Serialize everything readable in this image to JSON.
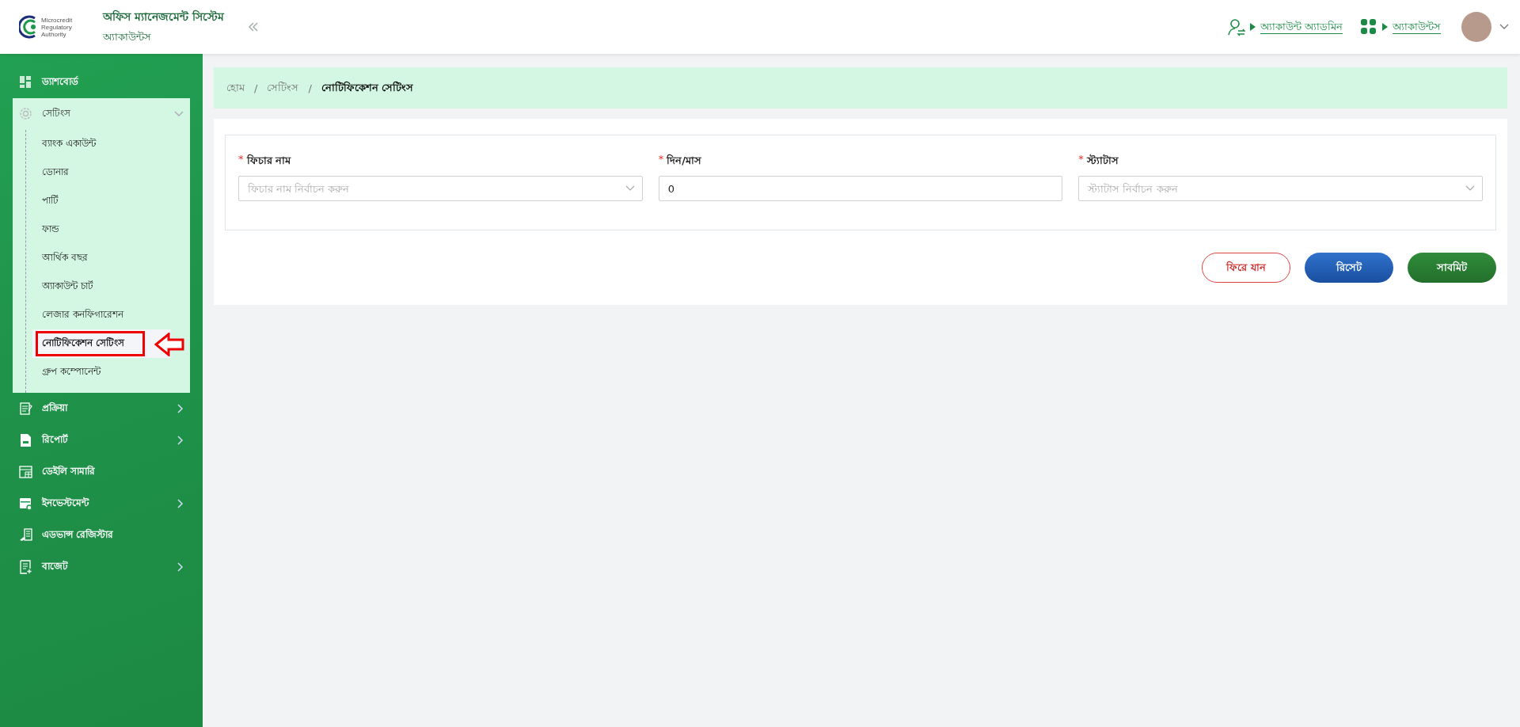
{
  "header": {
    "logo_lines": [
      "Microcredit",
      "Regulatory",
      "Authority"
    ],
    "title": "অফিস ম্যানেজমেন্ট সিস্টেম",
    "subtitle": "অ্যাকাউন্টস",
    "nav_links": [
      {
        "kind": "user-switch",
        "label": "অ্যাকাউন্ট অ্যাডমিন"
      },
      {
        "kind": "apps",
        "label": "অ্যাকাউন্টস"
      }
    ]
  },
  "sidebar": {
    "items": [
      {
        "label": "ড্যাশবোর্ড",
        "kind": "link"
      },
      {
        "label": "সেটিংস",
        "kind": "group",
        "expanded": true,
        "children": [
          {
            "label": "ব্যাংক একাউন্ট",
            "selected": false,
            "annotated": false
          },
          {
            "label": "ডোনার",
            "selected": false,
            "annotated": false
          },
          {
            "label": "পার্টি",
            "selected": false,
            "annotated": false
          },
          {
            "label": "ফান্ড",
            "selected": false,
            "annotated": false
          },
          {
            "label": "আর্থিক বছর",
            "selected": false,
            "annotated": false
          },
          {
            "label": "অ্যাকাউন্ট চার্ট",
            "selected": false,
            "annotated": false
          },
          {
            "label": "লেজার কনফিগারেশন",
            "selected": false,
            "annotated": false
          },
          {
            "label": "নোটিফিকেশন সেটিংস",
            "selected": true,
            "annotated": true
          },
          {
            "label": "গ্রুপ কম্পোনেন্ট",
            "selected": false,
            "annotated": false
          }
        ]
      },
      {
        "label": "প্রক্রিয়া",
        "kind": "group",
        "expanded": false
      },
      {
        "label": "রিপোর্ট",
        "kind": "group",
        "expanded": false
      },
      {
        "label": "ডেইলি সামারি",
        "kind": "link"
      },
      {
        "label": "ইনভেস্টমেন্ট",
        "kind": "group",
        "expanded": false
      },
      {
        "label": "এডভান্স রেজিস্টার",
        "kind": "link"
      },
      {
        "label": "বাজেট",
        "kind": "group",
        "expanded": false
      }
    ]
  },
  "breadcrumb": {
    "separator": "/",
    "items": [
      "হোম",
      "সেটিংস",
      "নোটিফিকেশন সেটিংস"
    ]
  },
  "form": {
    "fields": [
      {
        "kind": "select",
        "label": "ফিচার নাম",
        "required": true,
        "placeholder": "ফিচার নাম নির্বাচন করুন"
      },
      {
        "kind": "text",
        "label": "দিন/মাস",
        "required": true,
        "value": "0"
      },
      {
        "kind": "select",
        "label": "স্ট্যাটাস",
        "required": true,
        "placeholder": "স্ট্যাটাস নির্বাচন করুন"
      }
    ],
    "required_mark": "*",
    "buttons": [
      {
        "kind": "back",
        "label": "ফিরে যান"
      },
      {
        "kind": "reset",
        "label": "রিসেট"
      },
      {
        "kind": "submit",
        "label": "সাবমিট"
      }
    ]
  }
}
